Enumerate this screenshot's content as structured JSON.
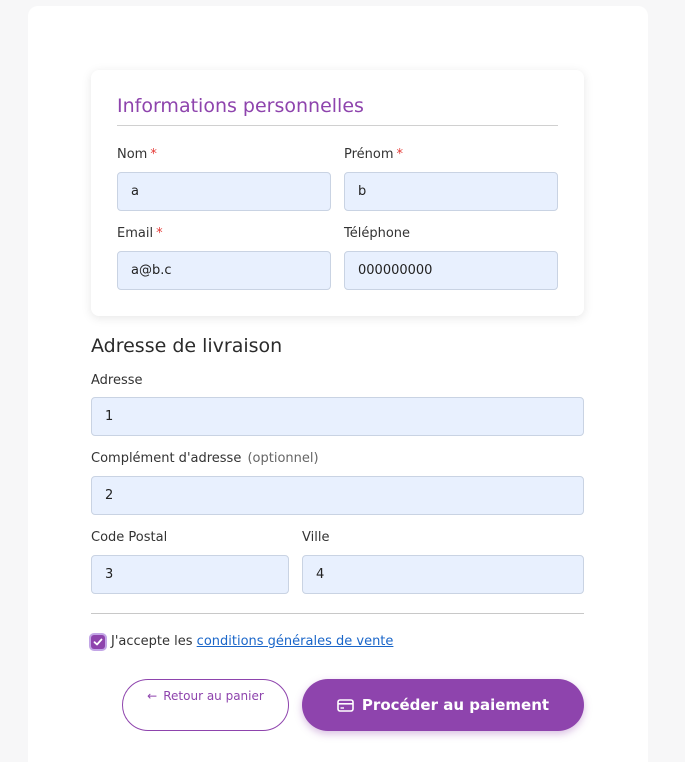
{
  "personal": {
    "title": "Informations personnelles",
    "nom": {
      "label": "Nom",
      "value": "a"
    },
    "prenom": {
      "label": "Prénom",
      "value": "b"
    },
    "email": {
      "label": "Email",
      "value": "a@b.c"
    },
    "telephone": {
      "label": "Téléphone",
      "value": "000000000"
    },
    "required_marker": "*"
  },
  "delivery": {
    "title": "Adresse de livraison",
    "adresse": {
      "label": "Adresse",
      "value": "1"
    },
    "complement": {
      "label": "Complément d'adresse",
      "optional": "(optionnel)",
      "value": "2"
    },
    "code_postal": {
      "label": "Code Postal",
      "value": "3"
    },
    "ville": {
      "label": "Ville",
      "value": "4"
    }
  },
  "terms": {
    "prefix": "J'accepte les",
    "link": "conditions générales de vente",
    "checked": true
  },
  "actions": {
    "back_arrow": "←",
    "back_label": "Retour au panier",
    "pay_label": "Procéder au paiement",
    "pay_icon": "credit-card-icon"
  },
  "colors": {
    "accent": "#8e44ad",
    "field_bg": "#e8f0fe",
    "required": "#e53935",
    "link": "#1a66c9"
  }
}
